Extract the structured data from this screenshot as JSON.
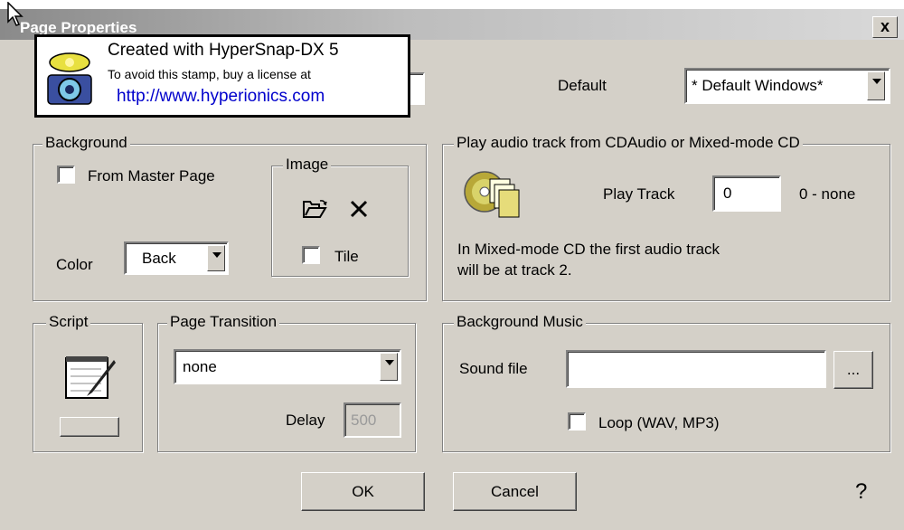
{
  "window": {
    "title": "Page Properties",
    "close_label": "x"
  },
  "stamp": {
    "line1": "Created with HyperSnap-DX 5",
    "line2": "To avoid this stamp, buy a license at",
    "line3": "http://www.hyperionics.com"
  },
  "top": {
    "default_label": "Default",
    "template_value": "* Default Windows*"
  },
  "background": {
    "group_label": "Background",
    "from_master_label": "From Master Page",
    "color_label": "Color",
    "color_value": "Back",
    "image_group_label": "Image",
    "tile_label": "Tile"
  },
  "audio": {
    "group_label": "Play audio track from CDAudio or Mixed-mode CD",
    "play_track_label": "Play Track",
    "play_track_value": "0",
    "track_hint": "0  - none",
    "note_line1": "In Mixed-mode CD the first audio track",
    "note_line2": "will be at track 2."
  },
  "script": {
    "group_label": "Script"
  },
  "transition": {
    "group_label": "Page Transition",
    "value": "none",
    "delay_label": "Delay",
    "delay_value": "500"
  },
  "music": {
    "group_label": "Background Music",
    "sound_file_label": "Sound file",
    "sound_file_value": "",
    "browse_label": "...",
    "loop_label": "Loop (WAV, MP3)"
  },
  "buttons": {
    "ok": "OK",
    "cancel": "Cancel",
    "help": "?"
  },
  "icons": {
    "open": "folder-open-icon",
    "delete": "x-delete-icon",
    "cd": "cd-audio-icon",
    "script": "notepad-script-icon",
    "help": "help-question-icon",
    "camera": "camera-icon"
  }
}
